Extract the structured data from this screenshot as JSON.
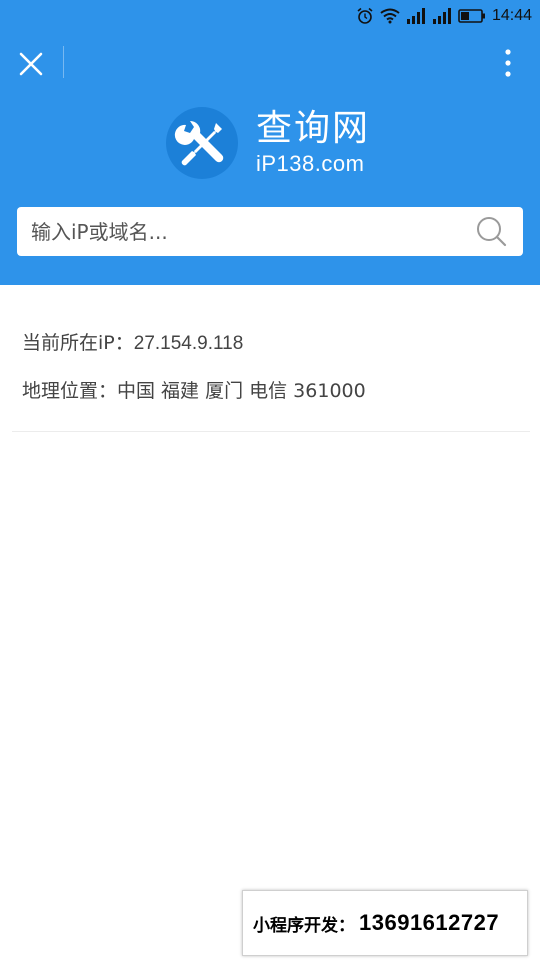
{
  "status_bar": {
    "time": "14:44"
  },
  "header": {
    "logo_title": "查询网",
    "logo_subtitle": "iP138.com"
  },
  "search": {
    "placeholder": "输入iP或域名..."
  },
  "info": {
    "ip_label": "当前所在iP：",
    "ip_value": "27.154.9.118",
    "location_label": "地理位置：",
    "location_value": "中国 福建 厦门 电信 361000"
  },
  "promo": {
    "label": "小程序开发：",
    "phone": "13691612727"
  },
  "colors": {
    "header_bg": "#2e93ea",
    "logo_circle": "#1c80d8"
  }
}
